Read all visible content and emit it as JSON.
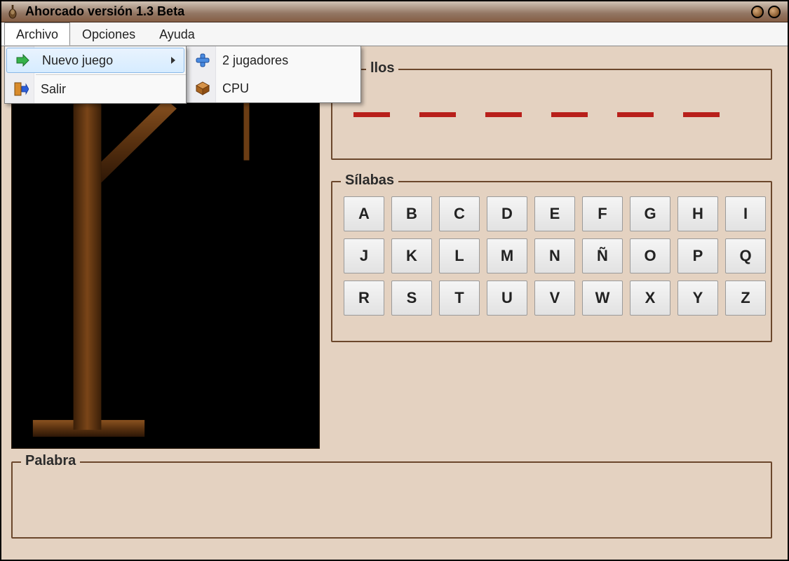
{
  "window": {
    "title": "Ahorcado versión 1.3 Beta"
  },
  "menubar": {
    "items": [
      "Archivo",
      "Opciones",
      "Ayuda"
    ],
    "active_index": 0
  },
  "dropdown": {
    "items": [
      {
        "label": "Nuevo juego",
        "has_submenu": true,
        "icon": "arrow-right-green"
      },
      {
        "label": "Salir",
        "has_submenu": false,
        "icon": "exit-door"
      }
    ],
    "hover_index": 0
  },
  "submenu": {
    "items": [
      {
        "label": "2 jugadores",
        "icon": "plus-blue"
      },
      {
        "label": "CPU",
        "icon": "box-brown"
      }
    ]
  },
  "sections": {
    "fallos_label": "llos",
    "silabas_label": "Sílabas",
    "palabra_label": "Palabra"
  },
  "fallos": {
    "dash_count": 6
  },
  "letters": [
    "A",
    "B",
    "C",
    "D",
    "E",
    "F",
    "G",
    "H",
    "I",
    "J",
    "K",
    "L",
    "M",
    "N",
    "Ñ",
    "O",
    "P",
    "Q",
    "R",
    "S",
    "T",
    "U",
    "V",
    "W",
    "X",
    "Y",
    "Z"
  ]
}
